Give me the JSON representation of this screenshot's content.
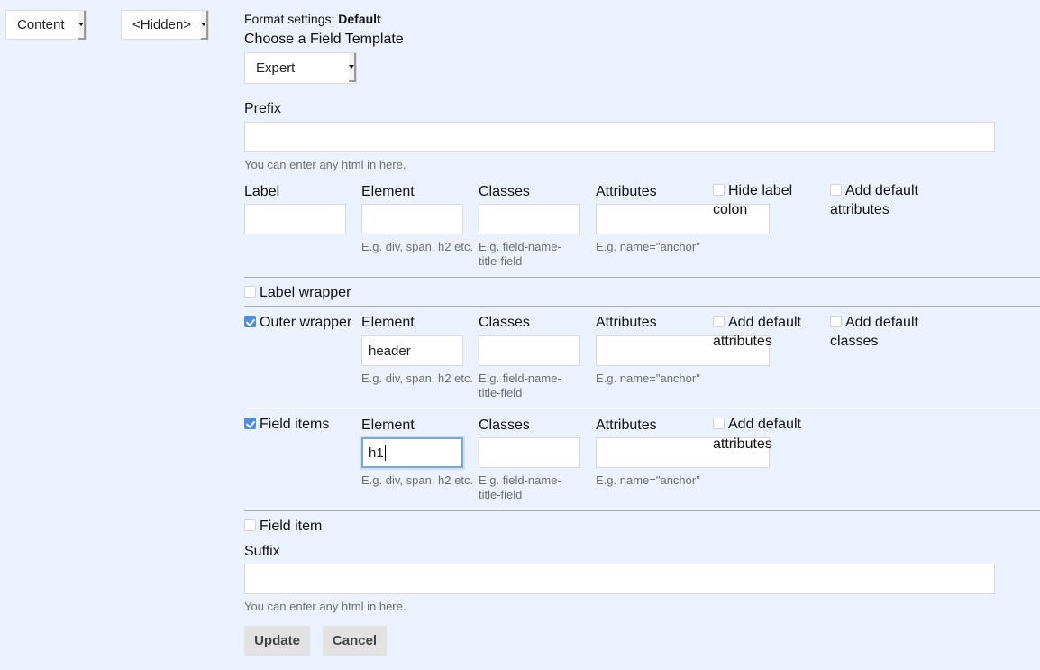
{
  "top_selects": {
    "region": "Content",
    "label_display": "<Hidden>"
  },
  "format_settings": {
    "prefix_label": "Format settings:",
    "value": "Default"
  },
  "field_template": {
    "heading": "Choose a Field Template",
    "selected": "Expert"
  },
  "prefix": {
    "label": "Prefix",
    "value": "",
    "help": "You can enter any html in here."
  },
  "label_row": {
    "label_col": "Label",
    "element_col": "Element",
    "classes_col": "Classes",
    "attributes_col": "Attributes",
    "label_value": "",
    "element_value": "",
    "classes_value": "",
    "attributes_value": "",
    "element_help": "E.g. div, span, h2 etc.",
    "classes_help": "E.g. field-name-title-field",
    "attributes_help": "E.g. name=\"anchor\"",
    "hide_colon": {
      "label": "Hide label colon",
      "checked": false
    },
    "add_default_attrs": {
      "label": "Add default attributes",
      "checked": false
    }
  },
  "label_wrapper": {
    "label": "Label wrapper",
    "checked": false
  },
  "outer_wrapper": {
    "label": "Outer wrapper",
    "checked": true,
    "element_col": "Element",
    "classes_col": "Classes",
    "attributes_col": "Attributes",
    "element_value": "header",
    "classes_value": "",
    "attributes_value": "",
    "element_help": "E.g. div, span, h2 etc.",
    "classes_help": "E.g. field-name-title-field",
    "attributes_help": "E.g. name=\"anchor\"",
    "add_default_attrs": {
      "label": "Add default attributes",
      "checked": false
    },
    "add_default_classes": {
      "label": "Add default classes",
      "checked": false
    }
  },
  "field_items": {
    "label": "Field items",
    "checked": true,
    "element_col": "Element",
    "classes_col": "Classes",
    "attributes_col": "Attributes",
    "element_value": "h1",
    "classes_value": "",
    "attributes_value": "",
    "element_help": "E.g. div, span, h2 etc.",
    "classes_help": "E.g. field-name-title-field",
    "attributes_help": "E.g. name=\"anchor\"",
    "add_default_attrs": {
      "label": "Add default attributes",
      "checked": false
    }
  },
  "field_item": {
    "label": "Field item",
    "checked": false
  },
  "suffix": {
    "label": "Suffix",
    "value": "",
    "help": "You can enter any html in here."
  },
  "buttons": {
    "update": "Update",
    "cancel": "Cancel"
  },
  "colors": {
    "background": "#ebf2fd",
    "checkbox_accent": "#4a8fe0",
    "focus_border": "#7aa7d9"
  }
}
